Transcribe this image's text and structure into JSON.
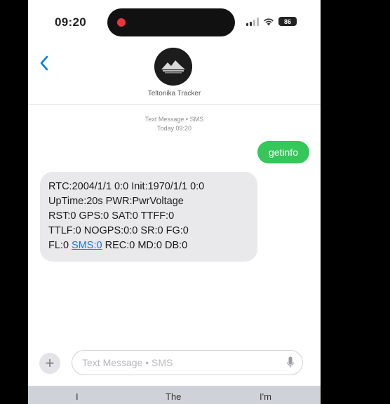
{
  "status_bar": {
    "time": "09:20",
    "battery": "86"
  },
  "header": {
    "contact_name": "Teltonika Tracker"
  },
  "conversation": {
    "service_label": "Text Message • SMS",
    "date_label": "Today 09:20"
  },
  "messages": {
    "outgoing_text": "getinfo",
    "incoming_lines": [
      "RTC:2004/1/1 0:0 Init:1970/1/1 0:0",
      "UpTime:20s PWR:PwrVoltage",
      "RST:0 GPS:0 SAT:0 TTFF:0",
      "TTLF:0 NOGPS:0:0 SR:0 FG:0"
    ],
    "last_line_prefix": "FL:0 ",
    "last_line_link": "SMS:0",
    "last_line_suffix": " REC:0 MD:0 DB:0"
  },
  "composer": {
    "plus_label": "+",
    "placeholder": "Text Message • SMS"
  },
  "keyboard": {
    "suggestions": [
      "I",
      "The",
      "I'm"
    ]
  },
  "colors": {
    "outgoing_bubble": "#34c759",
    "incoming_bubble": "#e9e9eb",
    "accent": "#007aff",
    "link": "#1a73e8"
  }
}
